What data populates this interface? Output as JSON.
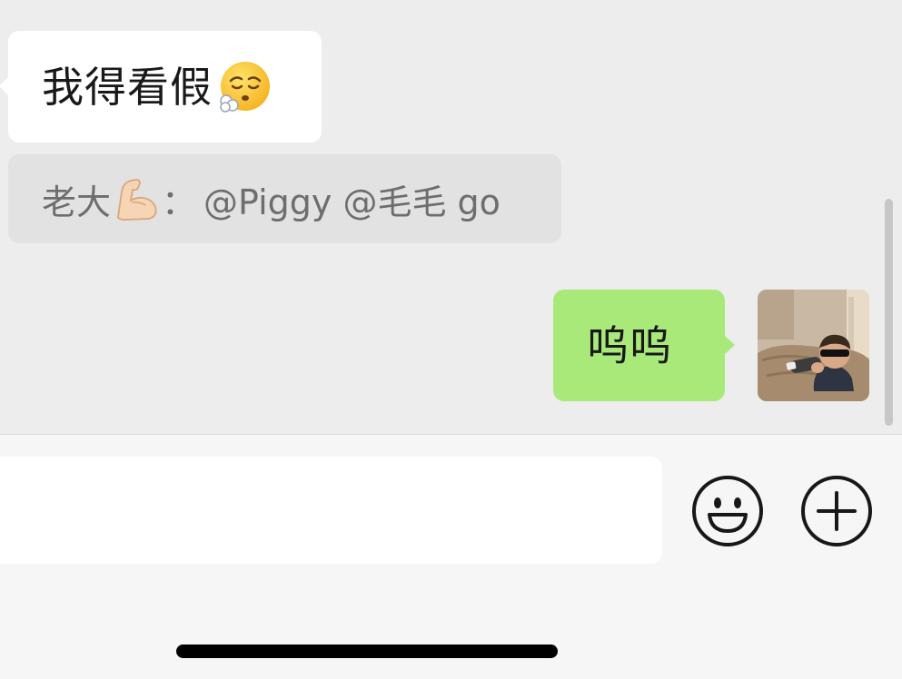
{
  "chat": {
    "received_message": {
      "text": "我得看假",
      "emoji": "face-exhaling-emoji"
    },
    "quote": {
      "sender": "老大",
      "sender_emoji": "flexed-biceps-emoji",
      "separator": "：",
      "text": "@Piggy @毛毛 go"
    },
    "sent_message": {
      "text": "呜呜",
      "avatar": "avatar-photo"
    }
  },
  "input_bar": {
    "placeholder": "",
    "emoji_button_icon": "smiley-icon",
    "more_button_icon": "plus-circle-icon"
  },
  "colors": {
    "background": "#EDEDED",
    "received_bubble": "#FFFFFF",
    "quote_bubble": "#E2E2E2",
    "sent_bubble": "#A9E97A",
    "input_bar": "#F6F6F6"
  }
}
